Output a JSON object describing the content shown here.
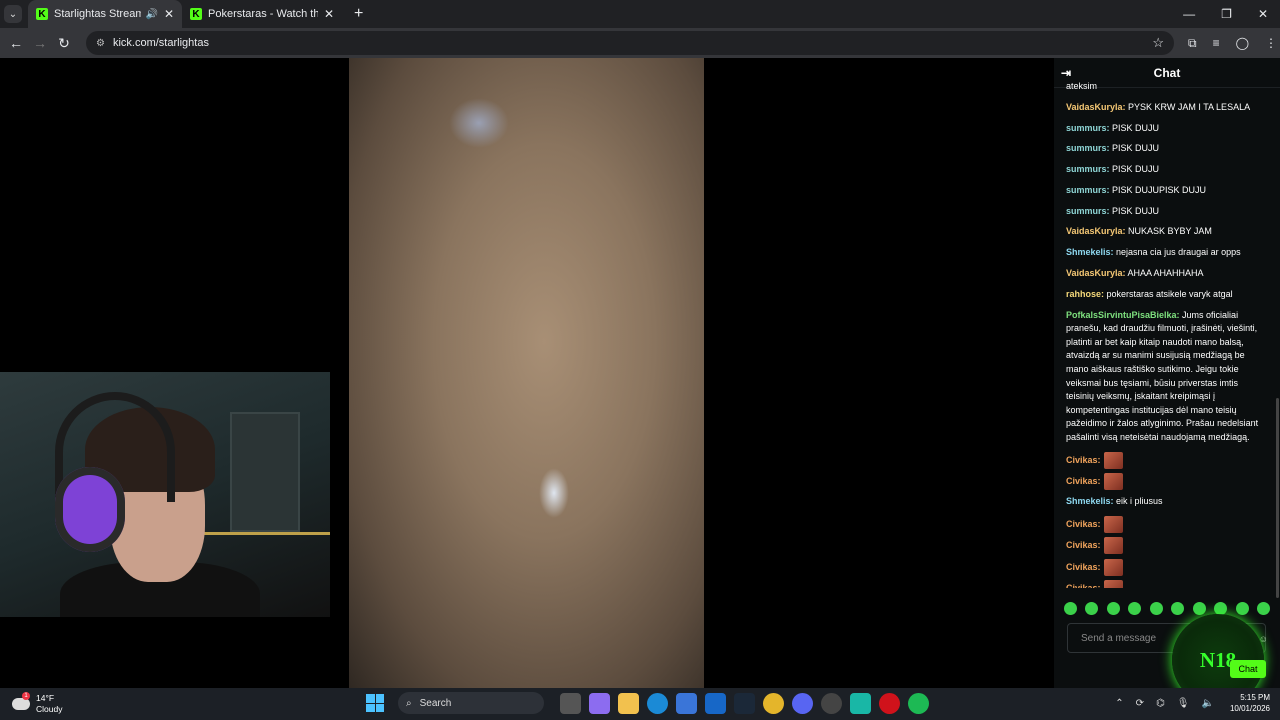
{
  "browser": {
    "tabs": [
      {
        "title": "Starlightas Stream - Watch",
        "active": true
      },
      {
        "title": "Pokerstaras - Watch the VOD o",
        "active": false
      }
    ],
    "url": "kick.com/starlightas"
  },
  "chat": {
    "title": "Chat",
    "messages": [
      {
        "user": "",
        "text": "ateksim",
        "color": "#ffffff"
      },
      {
        "user": "VaidasKuryla:",
        "text": " PYSK KRW JAM I TA LESALA",
        "color": "#f5c875"
      },
      {
        "user": "summurs:",
        "text": " PISK DUJU",
        "color": "#8fd6d6"
      },
      {
        "user": "summurs:",
        "text": " PISK DUJU",
        "color": "#8fd6d6"
      },
      {
        "user": "summurs:",
        "text": " PISK DUJU",
        "color": "#8fd6d6"
      },
      {
        "user": "summurs:",
        "text": " PISK DUJUPISK DUJU",
        "color": "#8fd6d6"
      },
      {
        "user": "summurs:",
        "text": " PISK DUJU",
        "color": "#8fd6d6"
      },
      {
        "user": "VaidasKuryla:",
        "text": " NUKASK BYBY JAM",
        "color": "#f5c875"
      },
      {
        "user": "Shmekelis:",
        "text": " nejasna cia jus draugai ar opps",
        "color": "#8ed8f0"
      },
      {
        "user": "VaidasKuryla:",
        "text": " AHAA AHAHHAHA",
        "color": "#f5c875"
      },
      {
        "user": "rahhose:",
        "text": " pokerstaras atsikele varyk atgal",
        "color": "#f5d97a"
      },
      {
        "user": "PofkalsSirvintuPisaBielka:",
        "text": " Jums oficialiai pranešu, kad draudžiu filmuoti, įrašinėti, viešinti, platinti ar bet kaip kitaip naudoti mano balsą, atvaizdą ar su manimi susijusią medžiagą be mano aiškaus raštiško sutikimo. Jeigu tokie veiksmai bus tęsiami, būsiu priverstas imtis teisinių veiksmų, įskaitant kreipimąsi į kompetentingas institucijas dėl mano teisių pažeidimo ir žalos atlyginimo. Prašau nedelsiant pašalinti visą neteisėtai naudojamą medžiagą.",
        "color": "#7ee07e"
      },
      {
        "user": "Civikas:",
        "text": "",
        "color": "#f0a35c",
        "emote": true
      },
      {
        "user": "Civikas:",
        "text": "",
        "color": "#f0a35c",
        "emote": true
      },
      {
        "user": "Shmekelis:",
        "text": " eik i pliusus",
        "color": "#8ed8f0"
      },
      {
        "user": "Civikas:",
        "text": "",
        "color": "#f0a35c",
        "emote": true
      },
      {
        "user": "Civikas:",
        "text": "",
        "color": "#f0a35c",
        "emote": true
      },
      {
        "user": "Civikas:",
        "text": "",
        "color": "#f0a35c",
        "emote": true
      },
      {
        "user": "Civikas:",
        "text": "",
        "color": "#f0a35c",
        "emote": true
      }
    ],
    "input_placeholder": "Send a message",
    "badge_text": "N18",
    "chat_button": "Chat"
  },
  "taskbar": {
    "weather_temp": "14°F",
    "weather_desc": "Cloudy",
    "weather_badge": "1",
    "search_placeholder": "Search",
    "time": "5:15 PM",
    "date": "10/01/2026"
  },
  "colors": {
    "accent": "#53fc18"
  }
}
